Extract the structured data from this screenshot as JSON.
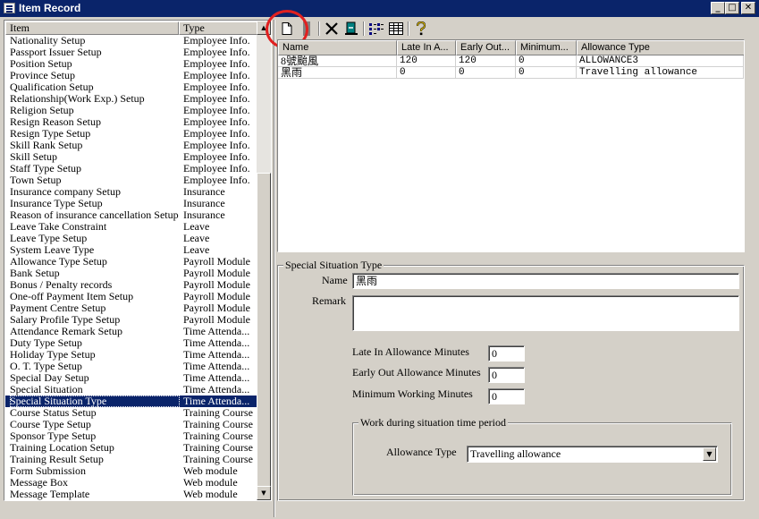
{
  "window": {
    "title": "Item Record",
    "buttons": {
      "minimize": "_",
      "maximize": "□",
      "close": "✕"
    }
  },
  "left_list": {
    "columns": [
      "Item",
      "Type"
    ],
    "rows": [
      {
        "item": "Nationality Setup",
        "type": "Employee Info."
      },
      {
        "item": "Passport Issuer Setup",
        "type": "Employee Info."
      },
      {
        "item": "Position Setup",
        "type": "Employee Info."
      },
      {
        "item": "Province Setup",
        "type": "Employee Info."
      },
      {
        "item": "Qualification Setup",
        "type": "Employee Info."
      },
      {
        "item": "Relationship(Work Exp.) Setup",
        "type": "Employee Info."
      },
      {
        "item": "Religion Setup",
        "type": "Employee Info."
      },
      {
        "item": "Resign Reason Setup",
        "type": "Employee Info."
      },
      {
        "item": "Resign Type Setup",
        "type": "Employee Info."
      },
      {
        "item": "Skill Rank Setup",
        "type": "Employee Info."
      },
      {
        "item": "Skill Setup",
        "type": "Employee Info."
      },
      {
        "item": "Staff Type Setup",
        "type": "Employee Info."
      },
      {
        "item": "Town Setup",
        "type": "Employee Info."
      },
      {
        "item": "Insurance company Setup",
        "type": "Insurance"
      },
      {
        "item": "Insurance Type Setup",
        "type": "Insurance"
      },
      {
        "item": "Reason of insurance cancellation Setup",
        "type": "Insurance"
      },
      {
        "item": "Leave Take Constraint",
        "type": "Leave"
      },
      {
        "item": "Leave Type Setup",
        "type": "Leave"
      },
      {
        "item": "System Leave Type",
        "type": "Leave"
      },
      {
        "item": "Allowance Type Setup",
        "type": "Payroll Module"
      },
      {
        "item": "Bank Setup",
        "type": "Payroll Module"
      },
      {
        "item": "Bonus / Penalty records",
        "type": "Payroll Module"
      },
      {
        "item": "One-off Payment Item Setup",
        "type": "Payroll Module"
      },
      {
        "item": "Payment Centre Setup",
        "type": "Payroll Module"
      },
      {
        "item": "Salary Profile Type Setup",
        "type": "Payroll Module"
      },
      {
        "item": "Attendance Remark Setup",
        "type": "Time Attenda..."
      },
      {
        "item": "Duty Type Setup",
        "type": "Time Attenda..."
      },
      {
        "item": "Holiday Type Setup",
        "type": "Time Attenda..."
      },
      {
        "item": "O. T. Type Setup",
        "type": "Time Attenda..."
      },
      {
        "item": "Special Day Setup",
        "type": "Time Attenda..."
      },
      {
        "item": "Special Situation",
        "type": "Time Attenda..."
      },
      {
        "item": "Special Situation Type",
        "type": "Time Attenda...",
        "selected": true
      },
      {
        "item": "Course Status Setup",
        "type": "Training Course"
      },
      {
        "item": "Course Type Setup",
        "type": "Training Course"
      },
      {
        "item": "Sponsor Type Setup",
        "type": "Training Course"
      },
      {
        "item": "Training Location Setup",
        "type": "Training Course"
      },
      {
        "item": "Training Result Setup",
        "type": "Training Course"
      },
      {
        "item": "Form Submission",
        "type": "Web module"
      },
      {
        "item": "Message Box",
        "type": "Web module"
      },
      {
        "item": "Message Template",
        "type": "Web module"
      }
    ]
  },
  "toolbar": {
    "buttons": [
      {
        "name": "new-icon",
        "glyph": "🗋"
      },
      {
        "name": "save-icon",
        "glyph": "▌"
      },
      {
        "name": "delete-icon",
        "glyph": "✕"
      },
      {
        "name": "exit-icon",
        "glyph": "⏏"
      },
      {
        "name": "list-view-icon",
        "glyph": "☷"
      },
      {
        "name": "detail-view-icon",
        "glyph": "▦"
      },
      {
        "name": "help-icon",
        "glyph": "?"
      }
    ]
  },
  "grid": {
    "columns": [
      "Name",
      "Late In A...",
      "Early Out...",
      "Minimum...",
      "Allowance Type"
    ],
    "rows": [
      {
        "name": "8號颱風",
        "late_in": "120",
        "early_out": "120",
        "minimum": "0",
        "allowance_type": "ALLOWANCE3"
      },
      {
        "name": "黑雨",
        "late_in": "0",
        "early_out": "0",
        "minimum": "0",
        "allowance_type": "Travelling allowance"
      }
    ]
  },
  "form": {
    "group_title": "Special Situation Type",
    "name_label": "Name",
    "name_value": "黑雨",
    "remark_label": "Remark",
    "remark_value": "",
    "late_in_label": "Late In Allowance Minutes",
    "late_in_value": "0",
    "early_out_label": "Early Out Allowance Minutes",
    "early_out_value": "0",
    "min_work_label": "Minimum Working Minutes",
    "min_work_value": "0",
    "period_group_title": "Work during situation time period",
    "allowance_label": "Allowance Type",
    "allowance_value": "Travelling allowance"
  },
  "colors": {
    "titlebar": "#0a246a",
    "selection": "#0a246a",
    "highlight_ring": "#e02020",
    "face": "#d4d0c8"
  }
}
